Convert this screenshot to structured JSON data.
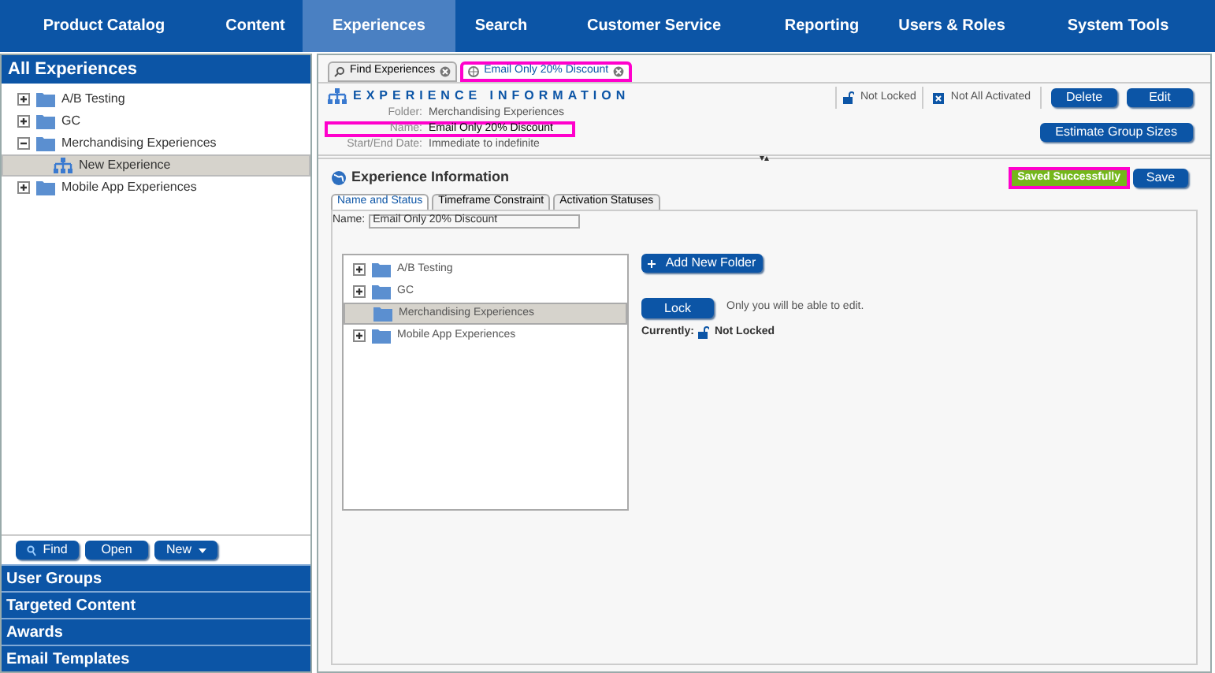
{
  "nav": [
    {
      "label": "Product Catalog",
      "selected": false
    },
    {
      "label": "Content",
      "selected": false
    },
    {
      "label": "Experiences",
      "selected": true
    },
    {
      "label": "Search",
      "selected": false
    },
    {
      "label": "Customer Service",
      "selected": false
    },
    {
      "label": "Reporting",
      "selected": false
    },
    {
      "label": "Users & Roles",
      "selected": false
    },
    {
      "label": "System Tools",
      "selected": false
    }
  ],
  "sidebar": {
    "title": "All Experiences",
    "tree": [
      {
        "label": "A/B Testing",
        "kind": "folder",
        "expanded": false,
        "selected": false
      },
      {
        "label": "GC",
        "kind": "folder",
        "expanded": false,
        "selected": false
      },
      {
        "label": "Merchandising Experiences",
        "kind": "folder",
        "expanded": true,
        "selected": false,
        "children": [
          {
            "label": "New Experience",
            "kind": "experience",
            "selected": true
          }
        ]
      },
      {
        "label": "Mobile App Experiences",
        "kind": "folder",
        "expanded": false,
        "selected": false
      }
    ],
    "buttons": [
      {
        "label": "Find",
        "kind": "search"
      },
      {
        "label": "Open",
        "kind": "plain"
      },
      {
        "label": "New",
        "kind": "menu"
      }
    ],
    "sections": [
      "User Groups",
      "Targeted Content",
      "Awards",
      "Email Templates"
    ]
  },
  "tabs": [
    {
      "label": "Find Experiences",
      "kind": "search",
      "selected": false,
      "highlighted": false
    },
    {
      "label": "Email Only 20% Discount",
      "kind": "experience",
      "selected": true,
      "highlighted": true
    }
  ],
  "info": {
    "title": "EXPERIENCE INFORMATION",
    "lock_status": "Not Locked",
    "activation_status": "Not All Activated",
    "fields": [
      {
        "label": "Folder:",
        "value": "Merchandising Experiences",
        "highlighted": false
      },
      {
        "label": "Name:",
        "value": "Email Only 20% Discount",
        "highlighted": true
      },
      {
        "label": "Start/End Date:",
        "value": "Immediate to indefinite",
        "highlighted": false
      }
    ],
    "buttons": [
      "Delete",
      "Edit"
    ],
    "estimate_button": "Estimate Group Sizes"
  },
  "editor": {
    "title": "Experience Information",
    "status": {
      "text": "Saved Successfully",
      "highlighted": true
    },
    "save_button": "Save",
    "tabs": [
      {
        "label": "Name and Status",
        "selected": true
      },
      {
        "label": "Timeframe Constraint",
        "selected": false
      },
      {
        "label": "Activation Statuses",
        "selected": false
      }
    ],
    "name_label": "Name:",
    "name_value": "Email Only 20% Discount",
    "folder_tree": [
      {
        "label": "A/B Testing",
        "expandable": true,
        "selected": false
      },
      {
        "label": "GC",
        "expandable": true,
        "selected": false
      },
      {
        "label": "Merchandising Experiences",
        "expandable": false,
        "selected": true
      },
      {
        "label": "Mobile App Experiences",
        "expandable": true,
        "selected": false
      }
    ],
    "add_folder_button": "Add New Folder",
    "lock_button": "Lock",
    "lock_hint": "Only you will be able to edit.",
    "currently_label": "Currently:",
    "currently_value": "Not Locked"
  }
}
